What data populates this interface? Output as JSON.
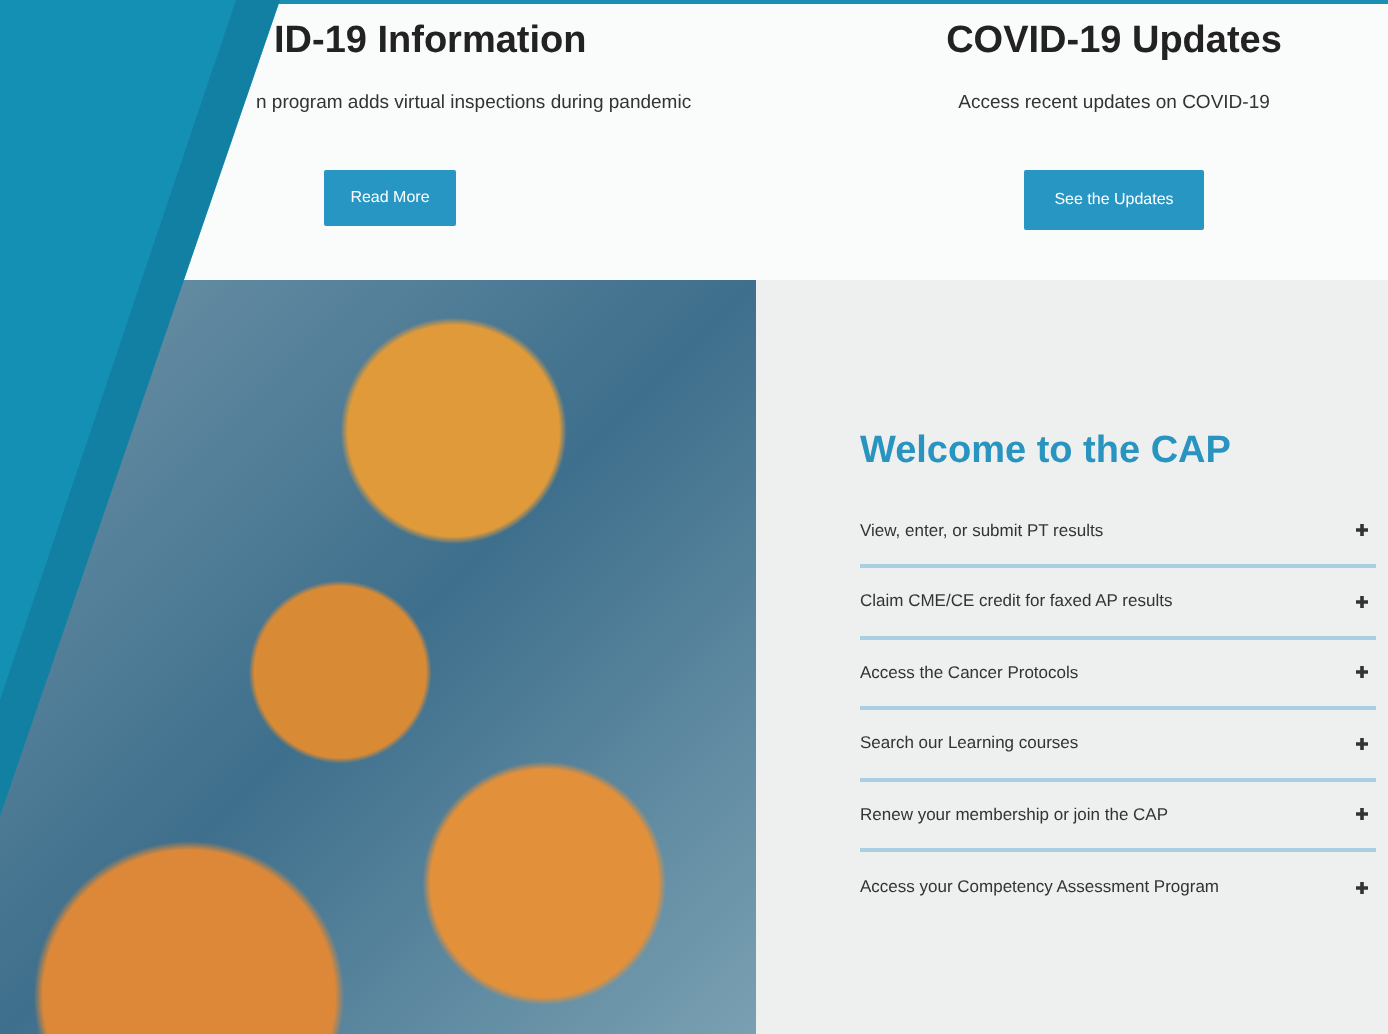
{
  "info_cards": [
    {
      "title": "ID-19 Information",
      "text": "n program adds virtual inspections during pandemic",
      "button": "Read More"
    },
    {
      "title": "COVID-19 Updates",
      "text": "Access recent updates on COVID-19",
      "button": "See the Updates"
    }
  ],
  "welcome": {
    "title": "Welcome to the CAP",
    "links": [
      "View, enter, or submit PT results",
      "Claim CME/CE credit for faxed AP results",
      "Access the Cancer Protocols",
      "Search our Learning courses",
      "Renew your membership or join the CAP",
      "Access your Competency Assessment Program"
    ]
  }
}
